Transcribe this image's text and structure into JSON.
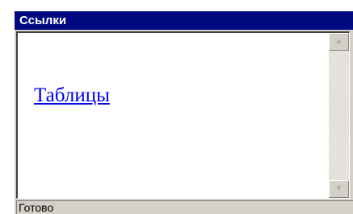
{
  "window": {
    "title": "Ссылки"
  },
  "content": {
    "link_text": "Таблицы"
  },
  "scrollbar": {
    "up_icon": "scroll-up-arrow",
    "down_icon": "scroll-down-arrow",
    "up_glyph": "▲",
    "down_glyph": "▼"
  },
  "status": {
    "text": "Готово"
  },
  "colors": {
    "titlebar": "#000a80",
    "link": "#0000ee",
    "chrome": "#d4d0c8"
  }
}
